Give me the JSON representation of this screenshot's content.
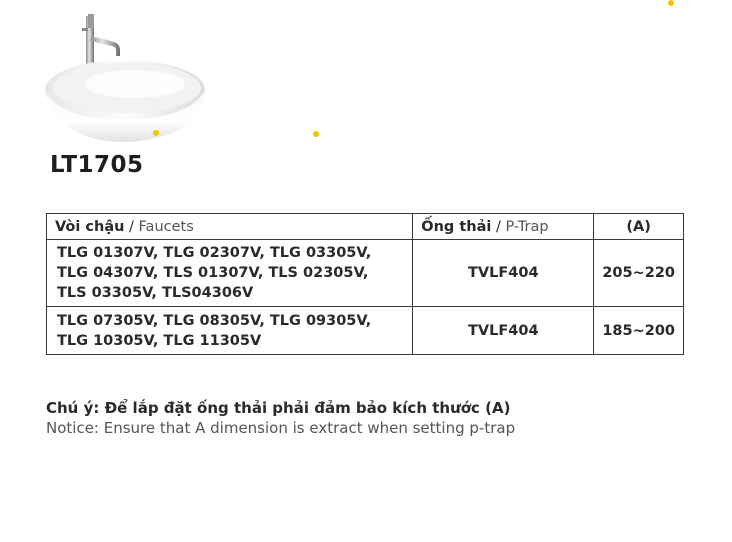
{
  "product": {
    "model": "LT1705"
  },
  "table": {
    "header": {
      "faucets_vi": "Vòi chậu",
      "faucets_sep": " / ",
      "faucets_en": "Faucets",
      "ptrap_vi": "Ống thải",
      "ptrap_sep": " / ",
      "ptrap_en": "P-Trap",
      "dimension": "(A)"
    },
    "rows": [
      {
        "faucets": [
          "TLG 01307V, TLG 02307V, TLG 03305V,",
          "TLG 04307V, TLS 01307V, TLS 02305V,",
          "TLS 03305V, TLS04306V"
        ],
        "ptrap": "TVLF404",
        "dimension": "205~220"
      },
      {
        "faucets": [
          "TLG 07305V, TLG 08305V, TLG 09305V,",
          "TLG 10305V, TLG 11305V"
        ],
        "ptrap": "TVLF404",
        "dimension": "185~200"
      }
    ]
  },
  "notice": {
    "vi": "Chú ý: Để lắp đặt ống thải phải đảm bảo kích thước (A)",
    "en": "Notice: Ensure that A dimension is extract when setting p-trap"
  },
  "colors": {
    "accent_dot": "#f5c400",
    "border": "#3a3a3a",
    "text": "#2a2a2a",
    "muted_text": "#555555"
  }
}
